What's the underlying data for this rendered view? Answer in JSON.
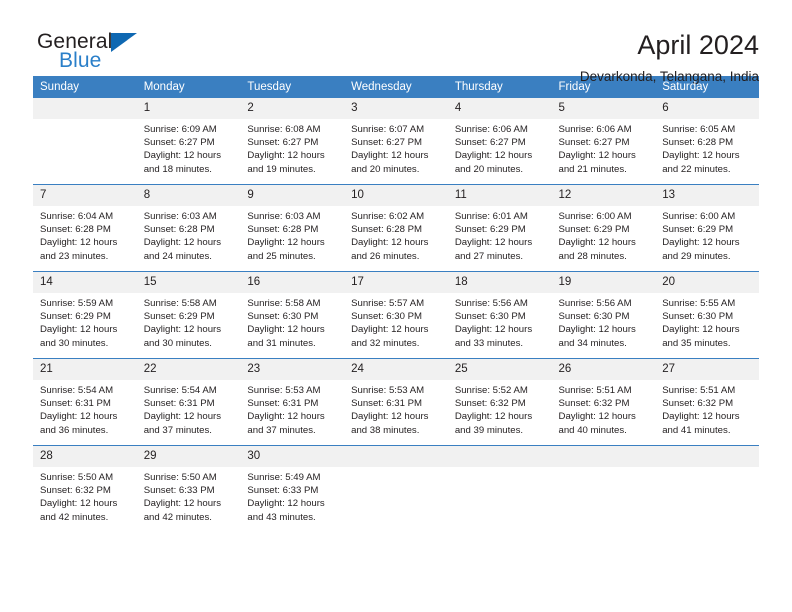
{
  "brand": {
    "word_one": "General",
    "word_two": "Blue",
    "triangle_icon": "brand-triangle-icon"
  },
  "header": {
    "title": "April 2024",
    "subtitle": "Devarkonda, Telangana, India"
  },
  "colors": {
    "header_blue": "#3a7fc1",
    "brand_blue": "#2a7fc9",
    "triangle_blue": "#0f68b2",
    "daynum_band": "#f1f1f1",
    "text": "#231f20"
  },
  "calendar": {
    "weekdays": [
      "Sunday",
      "Monday",
      "Tuesday",
      "Wednesday",
      "Thursday",
      "Friday",
      "Saturday"
    ],
    "labels": {
      "sunrise": "Sunrise:",
      "sunset": "Sunset:",
      "daylight": "Daylight:"
    },
    "weeks": [
      [
        {
          "day": "",
          "sunrise": "",
          "sunset": "",
          "daylight_line1": "",
          "daylight_line2": ""
        },
        {
          "day": "1",
          "sunrise": "Sunrise: 6:09 AM",
          "sunset": "Sunset: 6:27 PM",
          "daylight_line1": "Daylight: 12 hours",
          "daylight_line2": "and 18 minutes."
        },
        {
          "day": "2",
          "sunrise": "Sunrise: 6:08 AM",
          "sunset": "Sunset: 6:27 PM",
          "daylight_line1": "Daylight: 12 hours",
          "daylight_line2": "and 19 minutes."
        },
        {
          "day": "3",
          "sunrise": "Sunrise: 6:07 AM",
          "sunset": "Sunset: 6:27 PM",
          "daylight_line1": "Daylight: 12 hours",
          "daylight_line2": "and 20 minutes."
        },
        {
          "day": "4",
          "sunrise": "Sunrise: 6:06 AM",
          "sunset": "Sunset: 6:27 PM",
          "daylight_line1": "Daylight: 12 hours",
          "daylight_line2": "and 20 minutes."
        },
        {
          "day": "5",
          "sunrise": "Sunrise: 6:06 AM",
          "sunset": "Sunset: 6:27 PM",
          "daylight_line1": "Daylight: 12 hours",
          "daylight_line2": "and 21 minutes."
        },
        {
          "day": "6",
          "sunrise": "Sunrise: 6:05 AM",
          "sunset": "Sunset: 6:28 PM",
          "daylight_line1": "Daylight: 12 hours",
          "daylight_line2": "and 22 minutes."
        }
      ],
      [
        {
          "day": "7",
          "sunrise": "Sunrise: 6:04 AM",
          "sunset": "Sunset: 6:28 PM",
          "daylight_line1": "Daylight: 12 hours",
          "daylight_line2": "and 23 minutes."
        },
        {
          "day": "8",
          "sunrise": "Sunrise: 6:03 AM",
          "sunset": "Sunset: 6:28 PM",
          "daylight_line1": "Daylight: 12 hours",
          "daylight_line2": "and 24 minutes."
        },
        {
          "day": "9",
          "sunrise": "Sunrise: 6:03 AM",
          "sunset": "Sunset: 6:28 PM",
          "daylight_line1": "Daylight: 12 hours",
          "daylight_line2": "and 25 minutes."
        },
        {
          "day": "10",
          "sunrise": "Sunrise: 6:02 AM",
          "sunset": "Sunset: 6:28 PM",
          "daylight_line1": "Daylight: 12 hours",
          "daylight_line2": "and 26 minutes."
        },
        {
          "day": "11",
          "sunrise": "Sunrise: 6:01 AM",
          "sunset": "Sunset: 6:29 PM",
          "daylight_line1": "Daylight: 12 hours",
          "daylight_line2": "and 27 minutes."
        },
        {
          "day": "12",
          "sunrise": "Sunrise: 6:00 AM",
          "sunset": "Sunset: 6:29 PM",
          "daylight_line1": "Daylight: 12 hours",
          "daylight_line2": "and 28 minutes."
        },
        {
          "day": "13",
          "sunrise": "Sunrise: 6:00 AM",
          "sunset": "Sunset: 6:29 PM",
          "daylight_line1": "Daylight: 12 hours",
          "daylight_line2": "and 29 minutes."
        }
      ],
      [
        {
          "day": "14",
          "sunrise": "Sunrise: 5:59 AM",
          "sunset": "Sunset: 6:29 PM",
          "daylight_line1": "Daylight: 12 hours",
          "daylight_line2": "and 30 minutes."
        },
        {
          "day": "15",
          "sunrise": "Sunrise: 5:58 AM",
          "sunset": "Sunset: 6:29 PM",
          "daylight_line1": "Daylight: 12 hours",
          "daylight_line2": "and 30 minutes."
        },
        {
          "day": "16",
          "sunrise": "Sunrise: 5:58 AM",
          "sunset": "Sunset: 6:30 PM",
          "daylight_line1": "Daylight: 12 hours",
          "daylight_line2": "and 31 minutes."
        },
        {
          "day": "17",
          "sunrise": "Sunrise: 5:57 AM",
          "sunset": "Sunset: 6:30 PM",
          "daylight_line1": "Daylight: 12 hours",
          "daylight_line2": "and 32 minutes."
        },
        {
          "day": "18",
          "sunrise": "Sunrise: 5:56 AM",
          "sunset": "Sunset: 6:30 PM",
          "daylight_line1": "Daylight: 12 hours",
          "daylight_line2": "and 33 minutes."
        },
        {
          "day": "19",
          "sunrise": "Sunrise: 5:56 AM",
          "sunset": "Sunset: 6:30 PM",
          "daylight_line1": "Daylight: 12 hours",
          "daylight_line2": "and 34 minutes."
        },
        {
          "day": "20",
          "sunrise": "Sunrise: 5:55 AM",
          "sunset": "Sunset: 6:30 PM",
          "daylight_line1": "Daylight: 12 hours",
          "daylight_line2": "and 35 minutes."
        }
      ],
      [
        {
          "day": "21",
          "sunrise": "Sunrise: 5:54 AM",
          "sunset": "Sunset: 6:31 PM",
          "daylight_line1": "Daylight: 12 hours",
          "daylight_line2": "and 36 minutes."
        },
        {
          "day": "22",
          "sunrise": "Sunrise: 5:54 AM",
          "sunset": "Sunset: 6:31 PM",
          "daylight_line1": "Daylight: 12 hours",
          "daylight_line2": "and 37 minutes."
        },
        {
          "day": "23",
          "sunrise": "Sunrise: 5:53 AM",
          "sunset": "Sunset: 6:31 PM",
          "daylight_line1": "Daylight: 12 hours",
          "daylight_line2": "and 37 minutes."
        },
        {
          "day": "24",
          "sunrise": "Sunrise: 5:53 AM",
          "sunset": "Sunset: 6:31 PM",
          "daylight_line1": "Daylight: 12 hours",
          "daylight_line2": "and 38 minutes."
        },
        {
          "day": "25",
          "sunrise": "Sunrise: 5:52 AM",
          "sunset": "Sunset: 6:32 PM",
          "daylight_line1": "Daylight: 12 hours",
          "daylight_line2": "and 39 minutes."
        },
        {
          "day": "26",
          "sunrise": "Sunrise: 5:51 AM",
          "sunset": "Sunset: 6:32 PM",
          "daylight_line1": "Daylight: 12 hours",
          "daylight_line2": "and 40 minutes."
        },
        {
          "day": "27",
          "sunrise": "Sunrise: 5:51 AM",
          "sunset": "Sunset: 6:32 PM",
          "daylight_line1": "Daylight: 12 hours",
          "daylight_line2": "and 41 minutes."
        }
      ],
      [
        {
          "day": "28",
          "sunrise": "Sunrise: 5:50 AM",
          "sunset": "Sunset: 6:32 PM",
          "daylight_line1": "Daylight: 12 hours",
          "daylight_line2": "and 42 minutes."
        },
        {
          "day": "29",
          "sunrise": "Sunrise: 5:50 AM",
          "sunset": "Sunset: 6:33 PM",
          "daylight_line1": "Daylight: 12 hours",
          "daylight_line2": "and 42 minutes."
        },
        {
          "day": "30",
          "sunrise": "Sunrise: 5:49 AM",
          "sunset": "Sunset: 6:33 PM",
          "daylight_line1": "Daylight: 12 hours",
          "daylight_line2": "and 43 minutes."
        },
        {
          "day": "",
          "sunrise": "",
          "sunset": "",
          "daylight_line1": "",
          "daylight_line2": ""
        },
        {
          "day": "",
          "sunrise": "",
          "sunset": "",
          "daylight_line1": "",
          "daylight_line2": ""
        },
        {
          "day": "",
          "sunrise": "",
          "sunset": "",
          "daylight_line1": "",
          "daylight_line2": ""
        },
        {
          "day": "",
          "sunrise": "",
          "sunset": "",
          "daylight_line1": "",
          "daylight_line2": ""
        }
      ]
    ]
  }
}
